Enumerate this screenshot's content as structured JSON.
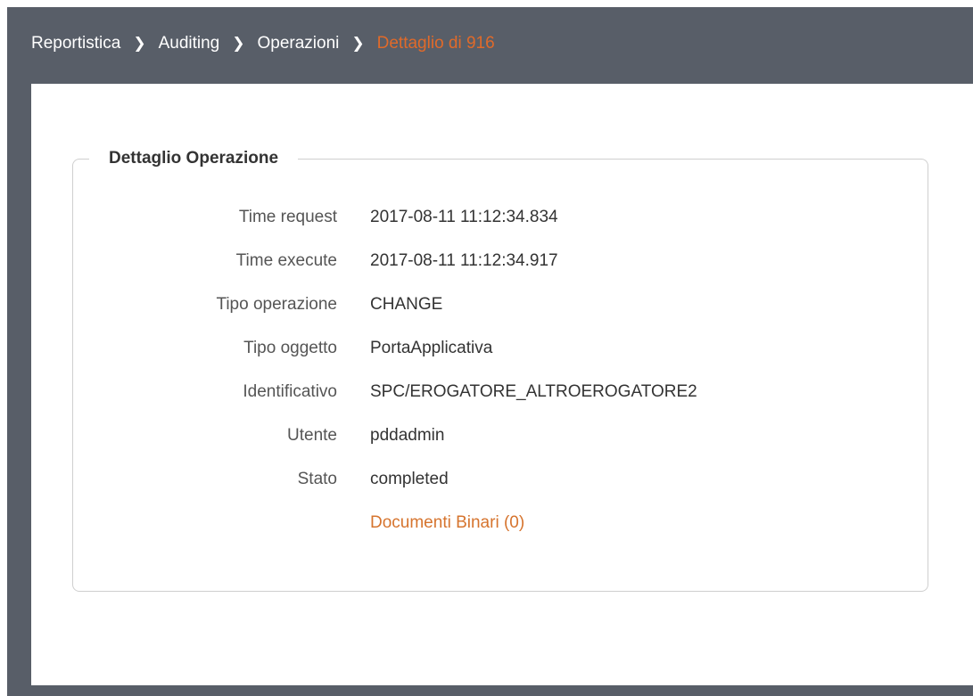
{
  "breadcrumb": {
    "items": [
      {
        "label": "Reportistica"
      },
      {
        "label": "Auditing"
      },
      {
        "label": "Operazioni"
      }
    ],
    "current": "Dettaglio di 916",
    "separator_icon": "chevron-right-icon"
  },
  "detail": {
    "legend": "Dettaglio Operazione",
    "fields": [
      {
        "label": "Time request",
        "value": "2017-08-11 11:12:34.834"
      },
      {
        "label": "Time execute",
        "value": "2017-08-11 11:12:34.917"
      },
      {
        "label": "Tipo operazione",
        "value": "CHANGE"
      },
      {
        "label": "Tipo oggetto",
        "value": "PortaApplicativa"
      },
      {
        "label": "Identificativo",
        "value": "SPC/EROGATORE_ALTROEROGATORE2"
      },
      {
        "label": "Utente",
        "value": "pddadmin"
      },
      {
        "label": "Stato",
        "value": "completed"
      }
    ],
    "binary_docs_link": "Documenti Binari (0)"
  },
  "colors": {
    "header_bg": "#585e68",
    "accent": "#e06a2a",
    "link": "#d6742e"
  }
}
